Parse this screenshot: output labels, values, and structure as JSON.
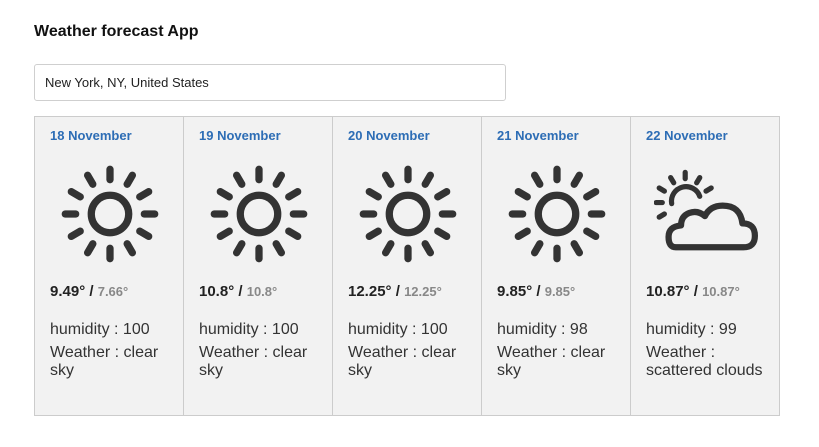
{
  "app": {
    "title": "Weather forecast App"
  },
  "search": {
    "value": "New York, NY, United States"
  },
  "forecast": [
    {
      "date": "18 November",
      "icon": "sun-icon",
      "temp_max": "9.49°",
      "temp_min": "7.66°",
      "humidity": "humidity : 100",
      "weather": "Weather : clear sky"
    },
    {
      "date": "19 November",
      "icon": "sun-icon",
      "temp_max": "10.8°",
      "temp_min": "10.8°",
      "humidity": "humidity : 100",
      "weather": "Weather : clear sky"
    },
    {
      "date": "20 November",
      "icon": "sun-icon",
      "temp_max": "12.25°",
      "temp_min": "12.25°",
      "humidity": "humidity : 100",
      "weather": "Weather : clear sky"
    },
    {
      "date": "21 November",
      "icon": "sun-icon",
      "temp_max": "9.85°",
      "temp_min": "9.85°",
      "humidity": "humidity : 98",
      "weather": "Weather : clear sky"
    },
    {
      "date": "22 November",
      "icon": "partly-cloudy-icon",
      "temp_max": "10.87°",
      "temp_min": "10.87°",
      "humidity": "humidity : 99",
      "weather": "Weather : scattered clouds"
    }
  ],
  "colors": {
    "date_text": "#2d6db5",
    "card_background": "#f2f2f2",
    "icon": "#333333",
    "min_temp": "#888888"
  }
}
